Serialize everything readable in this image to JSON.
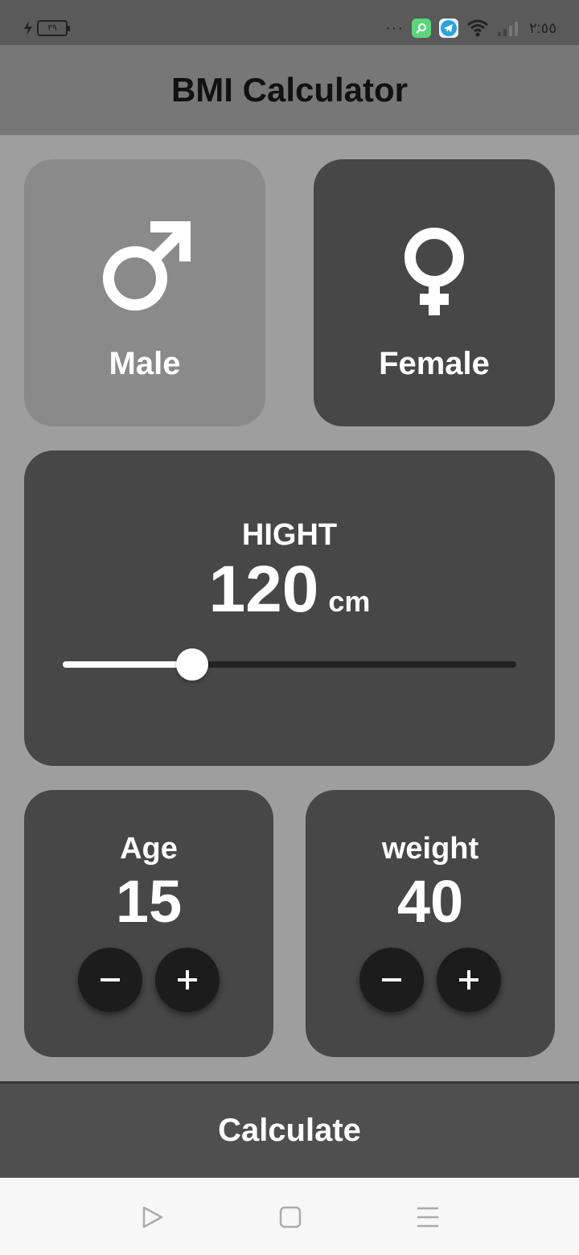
{
  "status_bar": {
    "battery": "٣٩",
    "dots": "···",
    "time": "٢:٥٥"
  },
  "app_bar": {
    "title": "BMI Calculator"
  },
  "gender": {
    "male_label": "Male",
    "female_label": "Female",
    "selected": "male"
  },
  "height": {
    "label": "HIGHT",
    "value": "120",
    "unit": "cm",
    "slider_fraction": 0.286
  },
  "age": {
    "label": "Age",
    "value": "15"
  },
  "weight": {
    "label": "weight",
    "value": "40"
  },
  "calculate_label": "Calculate",
  "colors": {
    "background": "#9e9e9e",
    "card": "#474747",
    "selected_card": "#8a8a8a",
    "app_bar": "#777777",
    "button": "#1c1c1c"
  }
}
